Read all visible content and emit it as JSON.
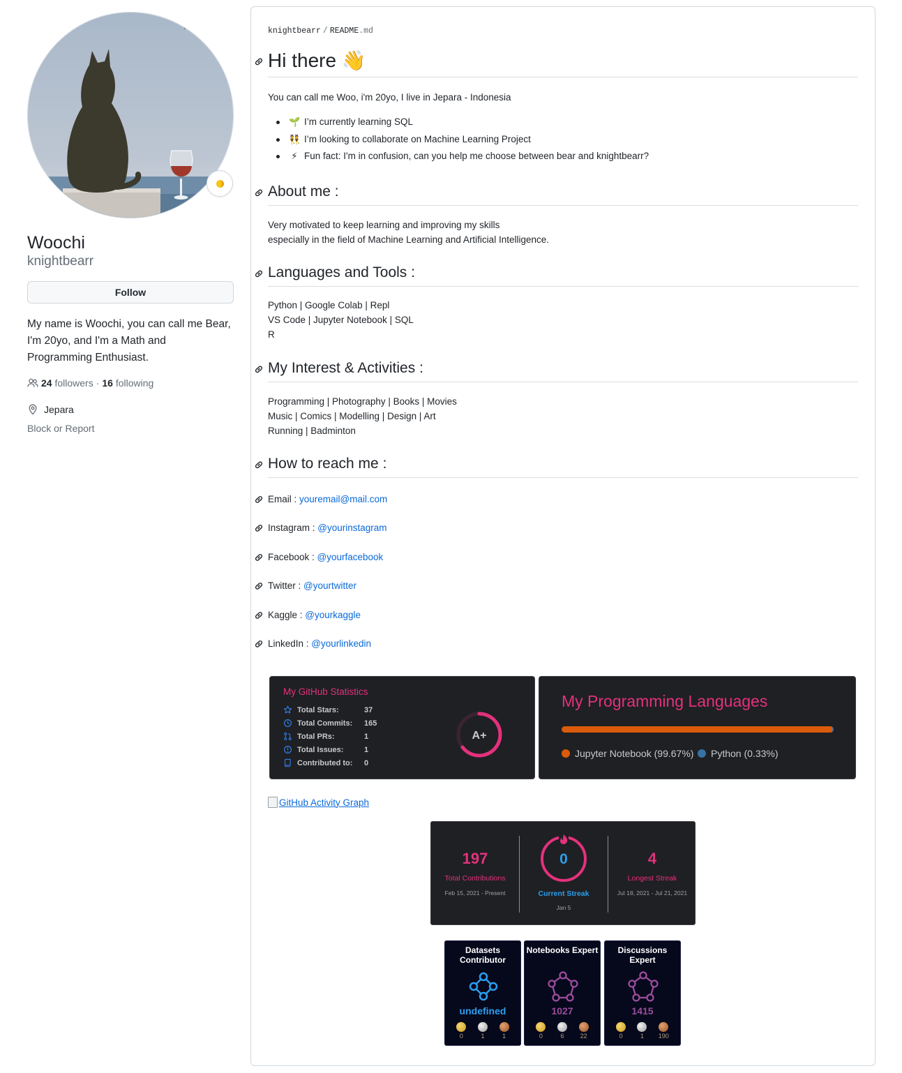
{
  "profile": {
    "name": "Woochi",
    "login": "knightbearr",
    "follow_label": "Follow",
    "bio": "My name is Woochi, you can call me Bear, I'm 20yo, and I'm a Math and Programming Enthusiast.",
    "followers_count": "24",
    "followers_label": "followers",
    "separator": "·",
    "following_count": "16",
    "following_label": "following",
    "location": "Jepara",
    "block_label": "Block or Report"
  },
  "readme": {
    "breadcrumb_owner": "knightbearr",
    "breadcrumb_sep": "/",
    "breadcrumb_file": "README",
    "breadcrumb_ext": ".md",
    "hi_heading": "Hi there 👋",
    "intro": "You can call me Woo, i'm 20yo, I live in Jepara - Indonesia",
    "bullets": [
      {
        "emoji": "🌱",
        "text": "I’m currently learning SQL"
      },
      {
        "emoji": "👯",
        "text": "I’m looking to collaborate on Machine Learning Project"
      },
      {
        "emoji": "⚡",
        "text": "Fun fact: I'm in confusion, can you help me choose between bear and knightbearr?"
      }
    ],
    "about_heading": "About me :",
    "about_lines": [
      "Very motivated to keep learning and improving my skills",
      "especially in the field of Machine Learning and Artificial Intelligence."
    ],
    "langs_heading": "Languages and Tools :",
    "langs_lines": [
      "Python | Google Colab | Repl",
      "VS Code | Jupyter Notebook | SQL",
      "R"
    ],
    "interest_heading": "My Interest & Activities :",
    "interest_lines": [
      "Programming | Photography | Books | Movies",
      "Music | Comics | Modelling | Design | Art",
      "Running | Badminton"
    ],
    "reach_heading": "How to reach me :",
    "contacts": [
      {
        "label": "Email : ",
        "link": "youremail@mail.com"
      },
      {
        "label": "Instagram : ",
        "link": "@yourinstagram"
      },
      {
        "label": "Facebook : ",
        "link": "@yourfacebook"
      },
      {
        "label": "Twitter : ",
        "link": "@yourtwitter"
      },
      {
        "label": "Kaggle : ",
        "link": "@yourkaggle"
      },
      {
        "label": "LinkedIn : ",
        "link": "@yourlinkedin"
      }
    ],
    "activity_graph_alt": "GitHub Activity Graph"
  },
  "github_stats": {
    "title": "My GitHub Statistics",
    "rows": [
      {
        "icon": "star-icon",
        "label": "Total Stars:",
        "value": "37"
      },
      {
        "icon": "clock-icon",
        "label": "Total Commits:",
        "value": "165"
      },
      {
        "icon": "pull-request-icon",
        "label": "Total PRs:",
        "value": "1"
      },
      {
        "icon": "issue-icon",
        "label": "Total Issues:",
        "value": "1"
      },
      {
        "icon": "repo-icon",
        "label": "Contributed to:",
        "value": "0"
      }
    ],
    "grade": "A+",
    "accent": "#e3317d",
    "icon_color": "#2f80ed"
  },
  "top_langs": {
    "title": "My Programming Languages",
    "languages": [
      {
        "name": "Jupyter Notebook",
        "percent": 99.67,
        "label": "Jupyter Notebook (99.67%)",
        "color": "#da5b0b"
      },
      {
        "name": "Python",
        "percent": 0.33,
        "label": "Python (0.33%)",
        "color": "#3572a5"
      }
    ]
  },
  "streak": {
    "total": {
      "value": "197",
      "label": "Total Contributions",
      "range": "Feb 15, 2021 - Present"
    },
    "current": {
      "value": "0",
      "label": "Current Streak",
      "range": "Jan 5"
    },
    "longest": {
      "value": "4",
      "label": "Longest Streak",
      "range": "Jul 18, 2021 - Jul 21, 2021"
    },
    "pink": "#e3317d",
    "blue": "#2b9ff0"
  },
  "kaggle": [
    {
      "title": "Datasets Contributor",
      "value": "undefined",
      "color": "#2b9ff0",
      "medals": [
        "0",
        "1",
        "1"
      ]
    },
    {
      "title": "Notebooks Expert",
      "value": "1027",
      "color": "#9b4d9c",
      "medals": [
        "0",
        "6",
        "22"
      ]
    },
    {
      "title": "Discussions Expert",
      "value": "1415",
      "color": "#9b4d9c",
      "medals": [
        "0",
        "1",
        "190"
      ]
    }
  ]
}
